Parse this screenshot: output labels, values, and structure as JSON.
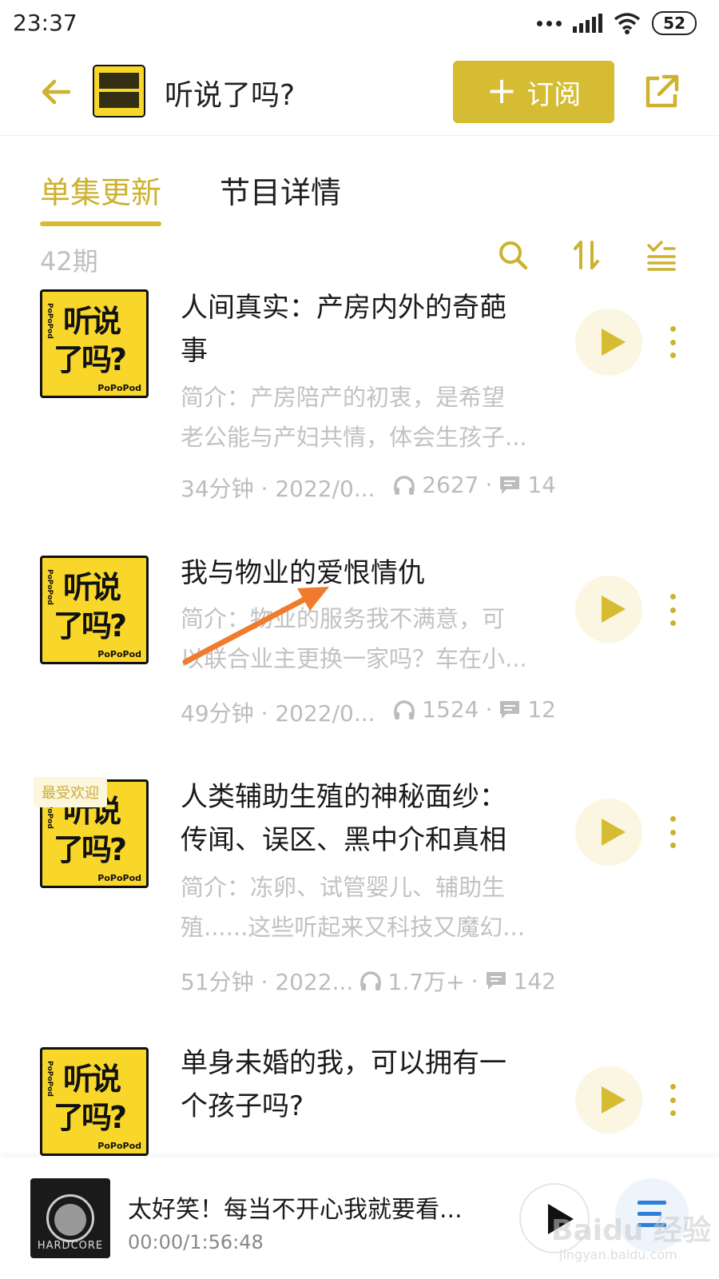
{
  "status_bar": {
    "time": "23:37",
    "battery": "52"
  },
  "header": {
    "title": "听说了吗?",
    "subscribe_label": "订阅",
    "subscribe_plus": "+"
  },
  "tabs": [
    {
      "label": "单集更新",
      "active": true
    },
    {
      "label": "节目详情",
      "active": false
    }
  ],
  "list": {
    "count": "42期"
  },
  "cover": {
    "line1": "听说",
    "line2": "了吗?",
    "brand": "PoPoPod",
    "side": "PoPoPod"
  },
  "episodes": [
    {
      "title_line1": "人间真实：产房内外的奇葩",
      "title_line2": "事",
      "desc_line1": "简介：产房陪产的初衷，是希望",
      "desc_line2": "老公能与产妇共情，体会生孩子...",
      "duration_date": "34分钟 · 2022/0...",
      "plays": "2627",
      "sep": "·",
      "comments": "14",
      "badge": ""
    },
    {
      "title_line1": "我与物业的爱恨情仇",
      "title_line2": "",
      "desc_line1": "简介：物业的服务我不满意，可",
      "desc_line2": "以联合业主更换一家吗？车在小...",
      "duration_date": "49分钟 · 2022/0...",
      "plays": "1524",
      "sep": "·",
      "comments": "12",
      "badge": ""
    },
    {
      "title_line1": "人类辅助生殖的神秘面纱：",
      "title_line2": "传闻、误区、黑中介和真相",
      "desc_line1": "简介：冻卵、试管婴儿、辅助生",
      "desc_line2": "殖......这些听起来又科技又魔幻...",
      "duration_date": "51分钟 · 2022...",
      "plays": "1.7万+",
      "sep": "·",
      "comments": "142",
      "badge": "最受欢迎"
    },
    {
      "title_line1": "单身未婚的我，可以拥有一",
      "title_line2": "个孩子吗?",
      "desc_line1": "",
      "desc_line2": "",
      "duration_date": "",
      "plays": "",
      "sep": "",
      "comments": "",
      "badge": ""
    }
  ],
  "player": {
    "title": "太好笑！每当不开心我就要看...",
    "time": "00:00/1:56:48",
    "art_label": "HARDCORE"
  },
  "watermark": {
    "main": "Baidu 经验",
    "sub": "jingyan.baidu.com"
  },
  "colors": {
    "accent": "#d5bc32",
    "accent_text": "#cdb12f",
    "arrow": "#f07b2c",
    "muted": "#c2c2c2"
  },
  "icons": [
    "back-arrow-icon",
    "share-icon",
    "search-icon",
    "sort-icon",
    "filter-list-icon",
    "play-icon",
    "more-vertical-icon",
    "headphones-icon",
    "comment-icon",
    "playlist-icon"
  ]
}
